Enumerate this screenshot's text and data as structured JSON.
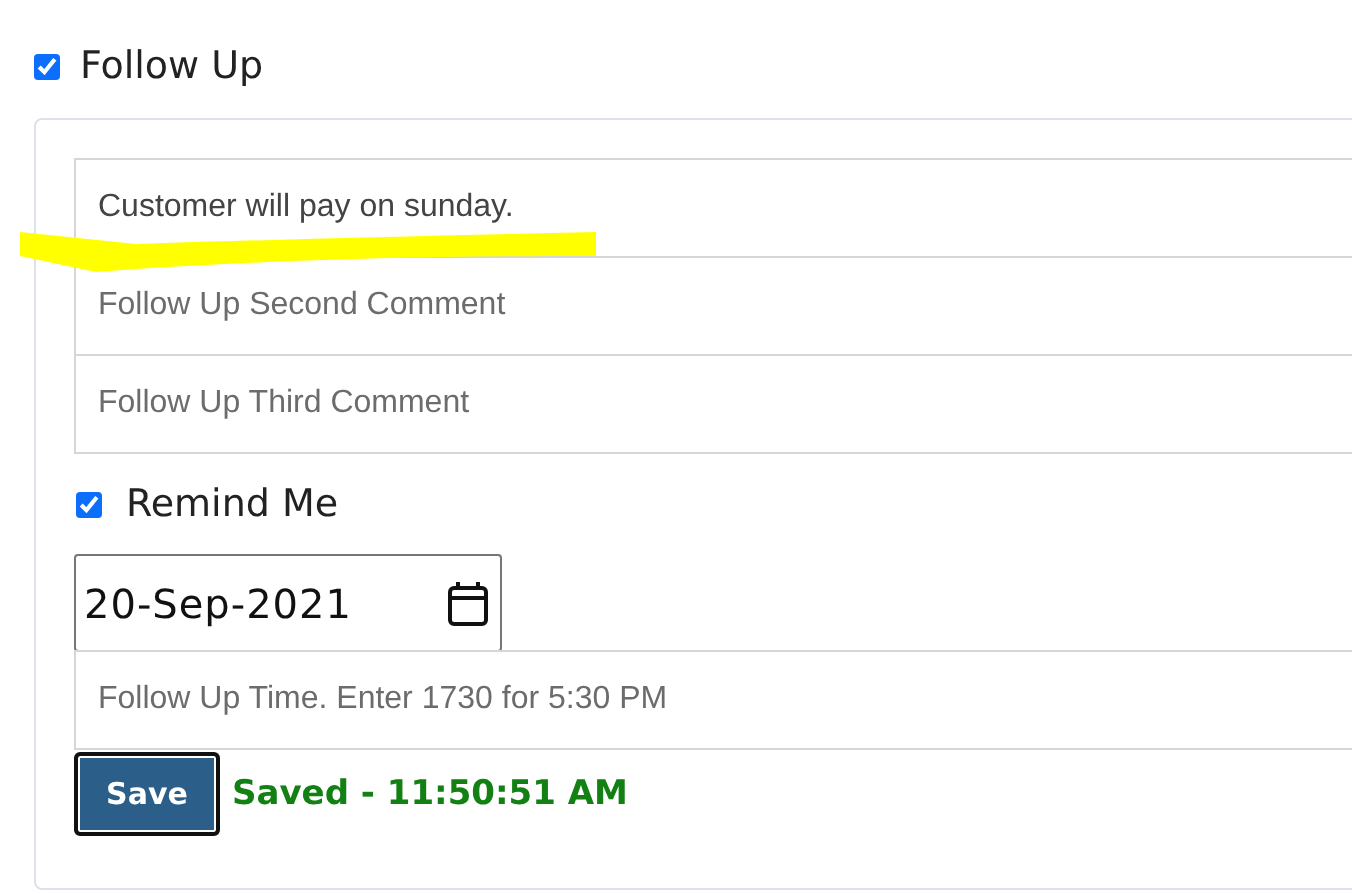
{
  "follow_up": {
    "label": "Follow Up",
    "checked": true
  },
  "comments": [
    {
      "value": "Customer will pay on sunday."
    },
    {
      "placeholder": "Follow Up Second Comment"
    },
    {
      "placeholder": "Follow Up Third Comment"
    }
  ],
  "remind_me": {
    "label": "Remind Me",
    "checked": true
  },
  "date": {
    "value": "20-Sep-2021"
  },
  "time": {
    "placeholder": "Follow Up Time. Enter 1730 for 5:30 PM"
  },
  "save_button": "Save",
  "status": "Saved - 11:50:51 AM"
}
